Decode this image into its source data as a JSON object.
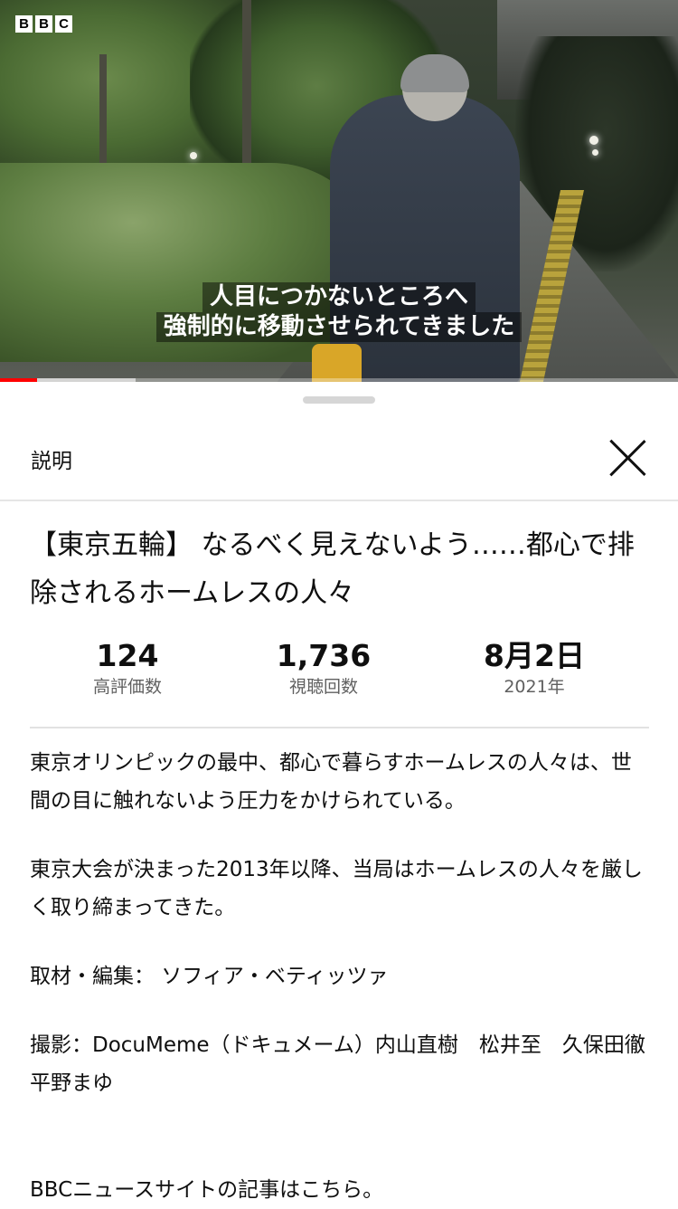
{
  "video": {
    "logo_letters": [
      "B",
      "B",
      "C"
    ],
    "subtitle_lines": [
      "人目につかないところへ",
      "強制的に移動させられてきました"
    ],
    "progress": {
      "played_fraction": 0.055,
      "buffered_fraction": 0.2
    },
    "accent_color": "#ff0000"
  },
  "sheet": {
    "header_title": "説明",
    "close_icon": "close-icon",
    "title": "【東京五輪】 なるべく見えないよう……都心で排除されるホームレスの人々",
    "stats": [
      {
        "value": "124",
        "label": "高評価数"
      },
      {
        "value": "1,736",
        "label": "視聴回数"
      },
      {
        "value": "8月2日",
        "label": "2021年"
      }
    ],
    "description": [
      "東京オリンピックの最中、都心で暮らすホームレスの人々は、世間の目に触れないよう圧力をかけられている。",
      "東京大会が決まった2013年以降、当局はホームレスの人々を厳しく取り締まってきた。",
      "取材・編集： ソフィア・ベティッツァ",
      "撮影：DocuMeme（ドキュメーム）内山直樹　松井至　久保田徹　平野まゆ",
      "BBCニュースサイトの記事はこちら。"
    ]
  }
}
